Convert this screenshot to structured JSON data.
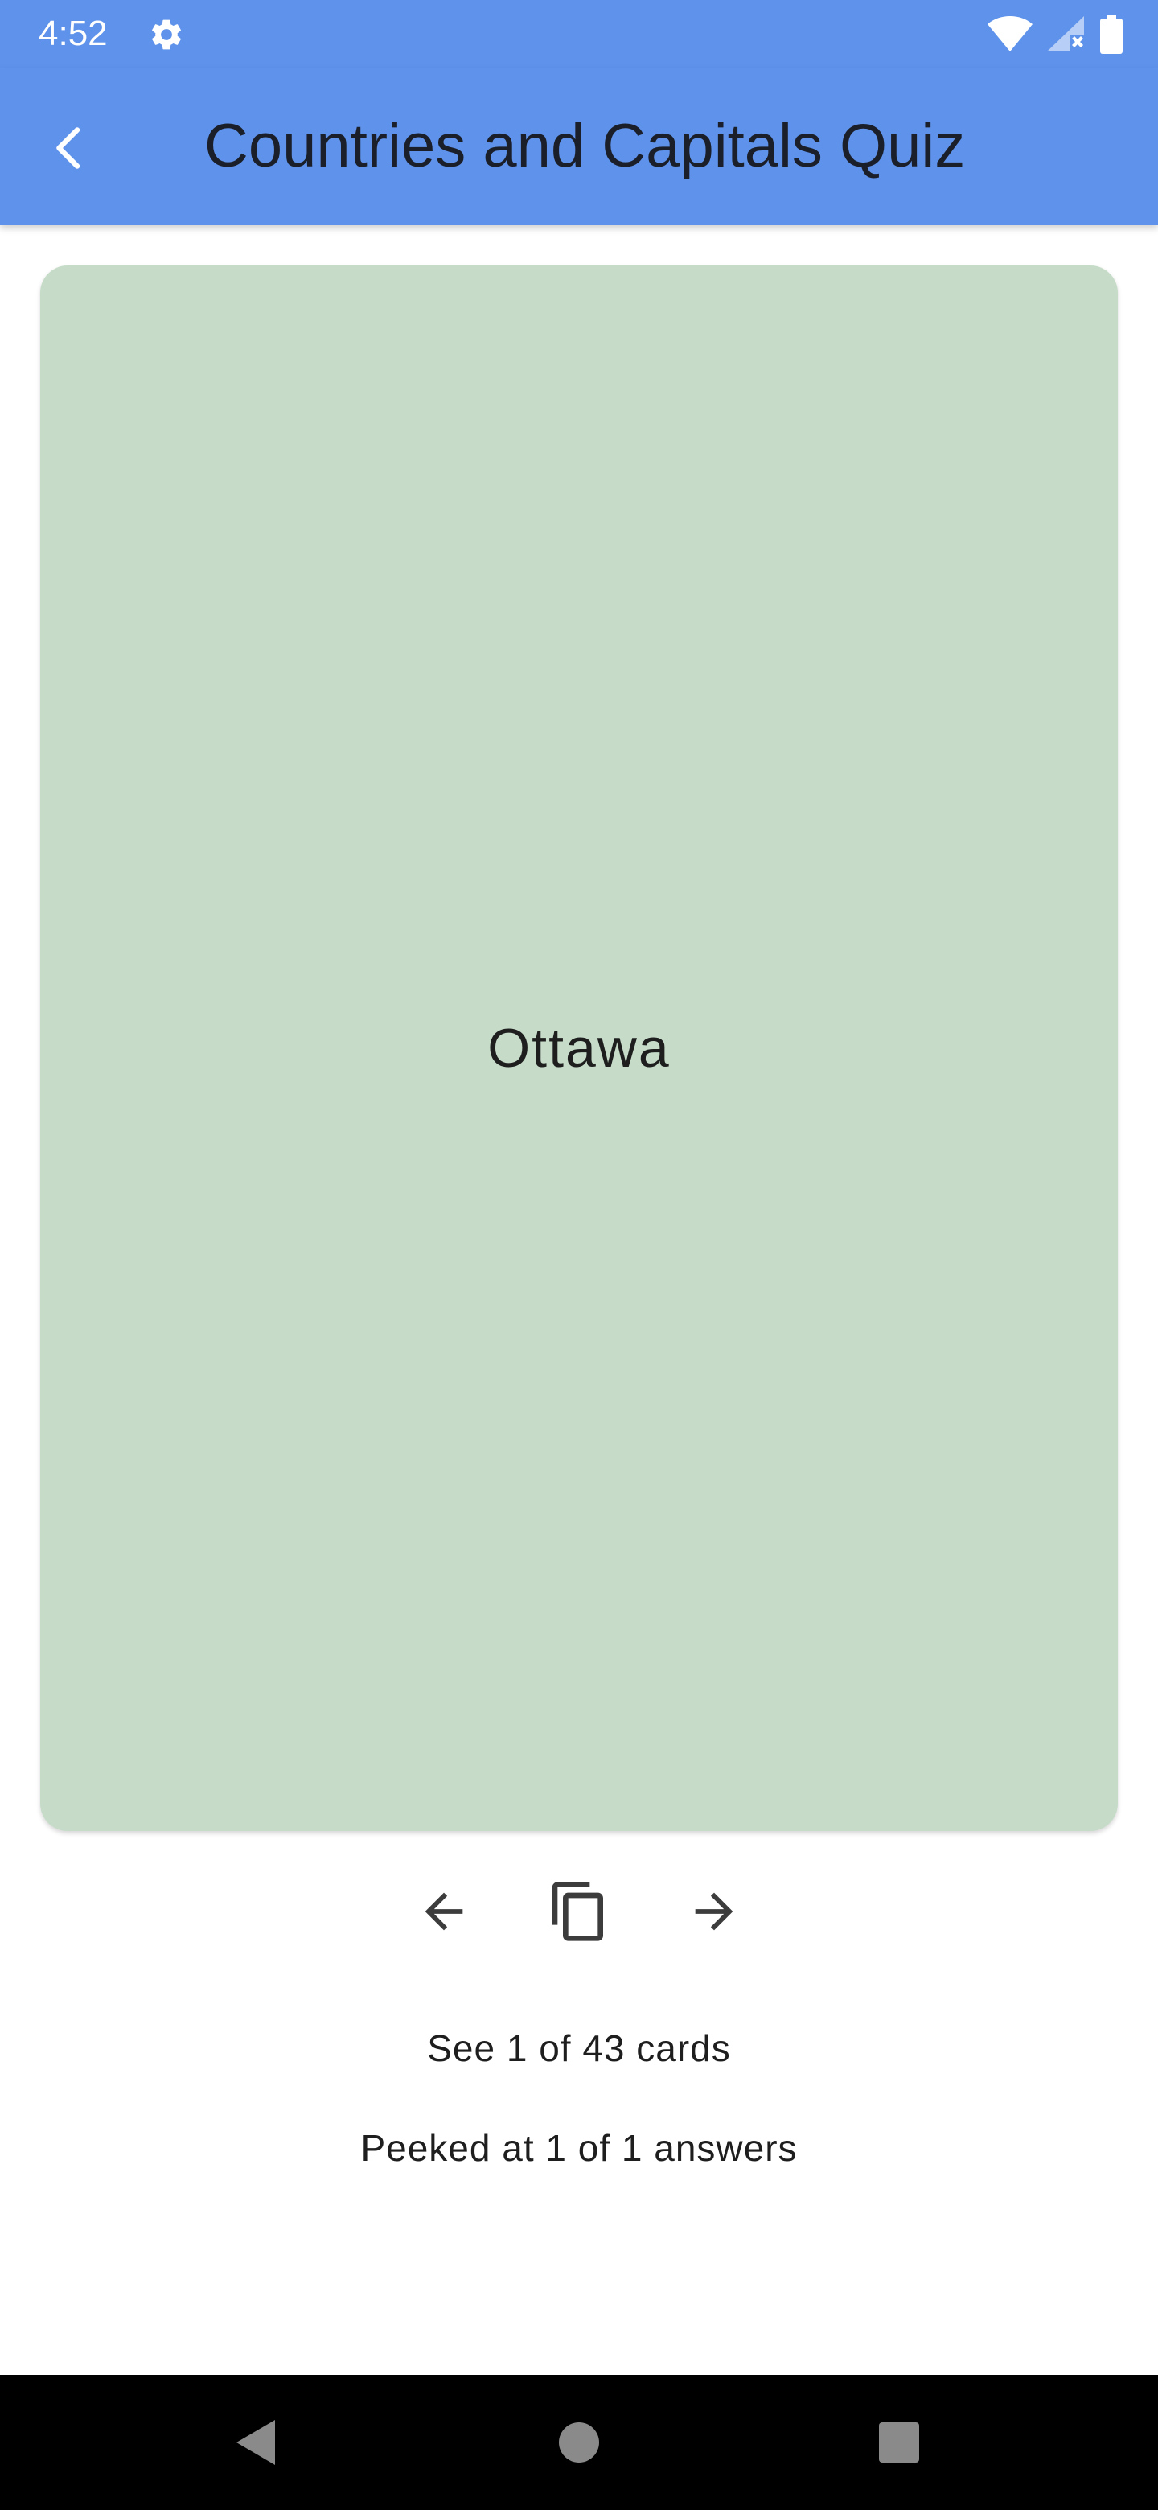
{
  "status_bar": {
    "time": "4:52",
    "icons": [
      "settings-icon",
      "wifi-icon",
      "signal-icon",
      "battery-icon"
    ]
  },
  "app_bar": {
    "title": "Countries and Capitals Quiz",
    "back_icon": "chevron-left-icon"
  },
  "card": {
    "text": "Ottawa",
    "color": "#c6dcc9"
  },
  "controls": {
    "previous_icon": "arrow-left-icon",
    "flip_icon": "copy-icon",
    "next_icon": "arrow-right-icon"
  },
  "progress": {
    "cards_text": "See 1 of 43 cards",
    "peek_text": "Peeked at 1 of 1 answers"
  },
  "nav_bar": {
    "icons": [
      "back-triangle-icon",
      "home-circle-icon",
      "recents-square-icon"
    ]
  },
  "colors": {
    "primary": "#5f93eb",
    "card": "#c6dcc9",
    "text": "#1e1e1e"
  }
}
